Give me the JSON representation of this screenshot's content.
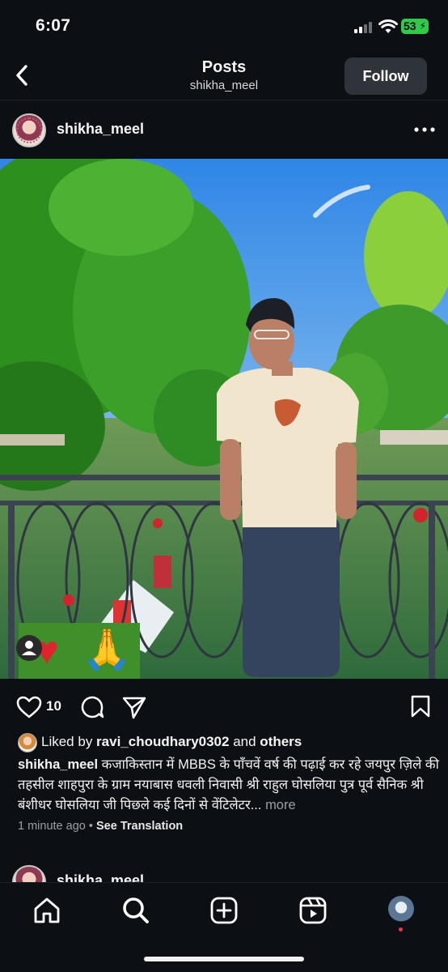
{
  "status_bar": {
    "time": "6:07",
    "battery": "53"
  },
  "header": {
    "title": "Posts",
    "subtitle": "shikha_meel",
    "follow_label": "Follow"
  },
  "post": {
    "username": "shikha_meel",
    "like_count": "10",
    "liked_by_prefix": "Liked by ",
    "liked_by_user": "ravi_choudhary0302",
    "liked_by_and": " and ",
    "liked_by_others": "others",
    "caption_user": "shikha_meel",
    "caption_text": "कजाकिस्तान में MBBS के पाँचवें वर्ष की पढ़ाई कर रहे जयपुर ज़िले की तहसील शाहपुरा के ग्राम नयाबास धवली निवासी श्री राहुल घोसलिया पुत्र पूर्व सैनिक श्री बंशीधर घोसलिया जी पिछले कई दिनों से वेंटिलेटर...",
    "caption_more": "more",
    "time_ago": "1 minute ago",
    "dot": "•",
    "see_translation": "See Translation"
  },
  "next_post": {
    "username": "shikha_meel",
    "dots": "•••"
  },
  "icons": {
    "back": "chevron-left-icon",
    "more": "more-horizontal-icon",
    "like": "heart-icon",
    "comment": "comment-icon",
    "share": "send-icon",
    "save": "bookmark-icon",
    "home": "home-icon",
    "search": "search-icon",
    "create": "plus-square-icon",
    "reels": "reels-icon"
  },
  "colors": {
    "background": "#0c0f14",
    "battery": "#31c94a",
    "notification_dot": "#ff3040"
  }
}
